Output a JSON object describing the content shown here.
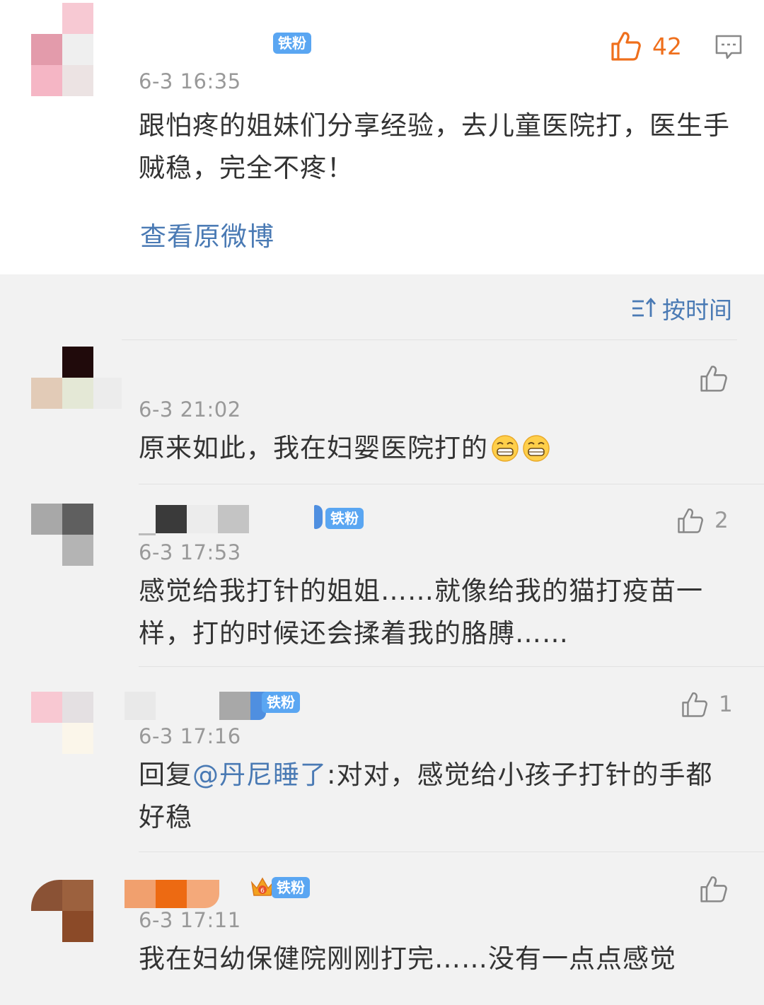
{
  "original_post": {
    "badge": "铁粉",
    "like_count": "42",
    "timestamp": "6-3 16:35",
    "text": "跟怕疼的姐妹们分享经验，去儿童医院打，医生手贼稳，完全不疼！",
    "view_original_label": "查看原微博"
  },
  "sort": {
    "label": "按时间"
  },
  "comments": [
    {
      "timestamp": "6-3 21:02",
      "text": "原来如此，我在妇婴医院打的",
      "like_count": ""
    },
    {
      "badge": "铁粉",
      "timestamp": "6-3 17:53",
      "text": "感觉给我打针的姐姐……就像给我的猫打疫苗一样，打的时候还会揉着我的胳膊……",
      "like_count": "2"
    },
    {
      "badge": "铁粉",
      "timestamp": "6-3 17:16",
      "reply_prefix": "回复",
      "mention": "@丹尼睡了",
      "text": ":对对，感觉给小孩子打针的手都好稳",
      "like_count": "1"
    },
    {
      "badge": "铁粉",
      "timestamp": "6-3 17:11",
      "text": "我在妇幼保健院刚刚打完……没有一点点感觉",
      "like_count": ""
    }
  ],
  "colors": {
    "link_blue": "#4a7ab4",
    "badge_blue": "#5aa6f2",
    "like_orange": "#ef6f1c",
    "muted_gray": "#999999"
  }
}
